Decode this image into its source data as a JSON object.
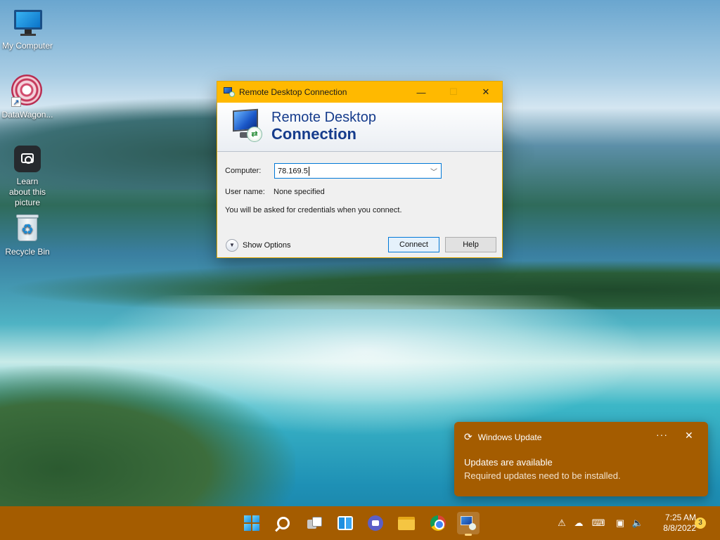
{
  "desktop": {
    "icons": [
      {
        "label": "My Computer",
        "icon": "monitor-icon"
      },
      {
        "label": "DataWagon...",
        "icon": "datawagon-icon"
      },
      {
        "label": "Learn about this picture",
        "icon": "camera-icon"
      },
      {
        "label": "Recycle Bin",
        "icon": "recycle-bin-icon"
      }
    ]
  },
  "window": {
    "title": "Remote Desktop Connection",
    "banner_line1": "Remote Desktop",
    "banner_line2": "Connection",
    "computer_label": "Computer:",
    "computer_value": "78.169.5",
    "username_label": "User name:",
    "username_value": "None specified",
    "credentials_note": "You will be asked for credentials when you connect.",
    "show_options_label": "Show Options",
    "connect_label": "Connect",
    "help_label": "Help"
  },
  "toast": {
    "app": "Windows Update",
    "heading": "Updates are available",
    "message": "Required updates need to be installed."
  },
  "taskbar": {
    "items": [
      "start-icon",
      "search-icon",
      "task-view-icon",
      "widgets-icon",
      "teams-chat-icon",
      "file-explorer-icon",
      "chrome-icon",
      "remote-desktop-icon"
    ],
    "time": "7:25 AM",
    "date": "8/8/2022",
    "notification_count": "3"
  },
  "colors": {
    "accent": "#ffb900",
    "taskbar": "#a45c00",
    "banner_text": "#163c8c"
  }
}
